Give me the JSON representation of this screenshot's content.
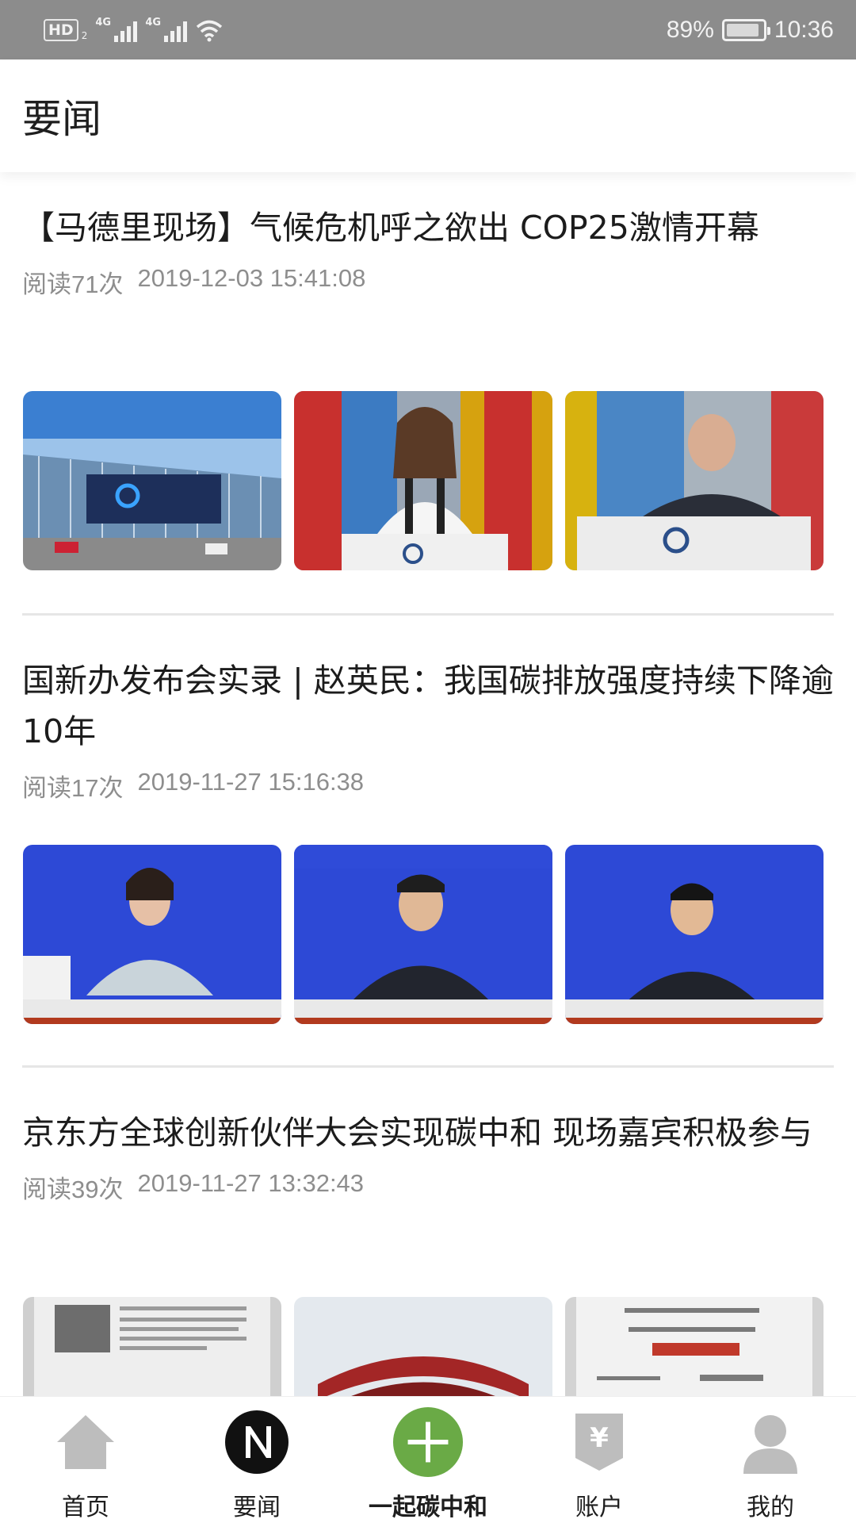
{
  "status_bar": {
    "hd": "HD",
    "sim": "2",
    "net1": "4G",
    "net2": "4G",
    "battery": "89%",
    "time": "10:36"
  },
  "header": {
    "title": "要闻"
  },
  "articles": [
    {
      "title": "【马德里现场】气候危机呼之欲出 COP25激情开幕",
      "reads": "阅读71次",
      "datetime": "2019-12-03 15:41:08",
      "images": [
        "feria-de-madrid-photo",
        "cop25-speaker-woman-photo",
        "cop25-speaker-man-photo"
      ]
    },
    {
      "title": "国新办发布会实录 | 赵英民：我国碳排放强度持续下降逾10年",
      "reads": "阅读17次",
      "datetime": "2019-11-27 15:16:38",
      "images": [
        "scio-press-woman-photo",
        "scio-press-man-photo",
        "scio-press-official-photo"
      ]
    },
    {
      "title": "京东方全球创新伙伴大会实现碳中和 现场嘉宾积极参与",
      "reads": "阅读39次",
      "datetime": "2019-11-27 13:32:43",
      "images": [
        "certificate-document-photo",
        "expo-building-photo",
        "climate-action-certificate-photo"
      ]
    }
  ],
  "bottom_nav": [
    {
      "label": "首页",
      "icon": "home-icon"
    },
    {
      "label": "要闻",
      "icon": "news-n-icon"
    },
    {
      "label": "一起碳中和",
      "icon": "plus-icon"
    },
    {
      "label": "账户",
      "icon": "yuan-account-icon"
    },
    {
      "label": "我的",
      "icon": "person-icon"
    }
  ],
  "colors": {
    "status_bar_bg": "#8c8c8c",
    "plus_green": "#6aaa46",
    "nav_icon_gray": "#bdbdbd",
    "meta_gray": "#8e8e8e"
  }
}
